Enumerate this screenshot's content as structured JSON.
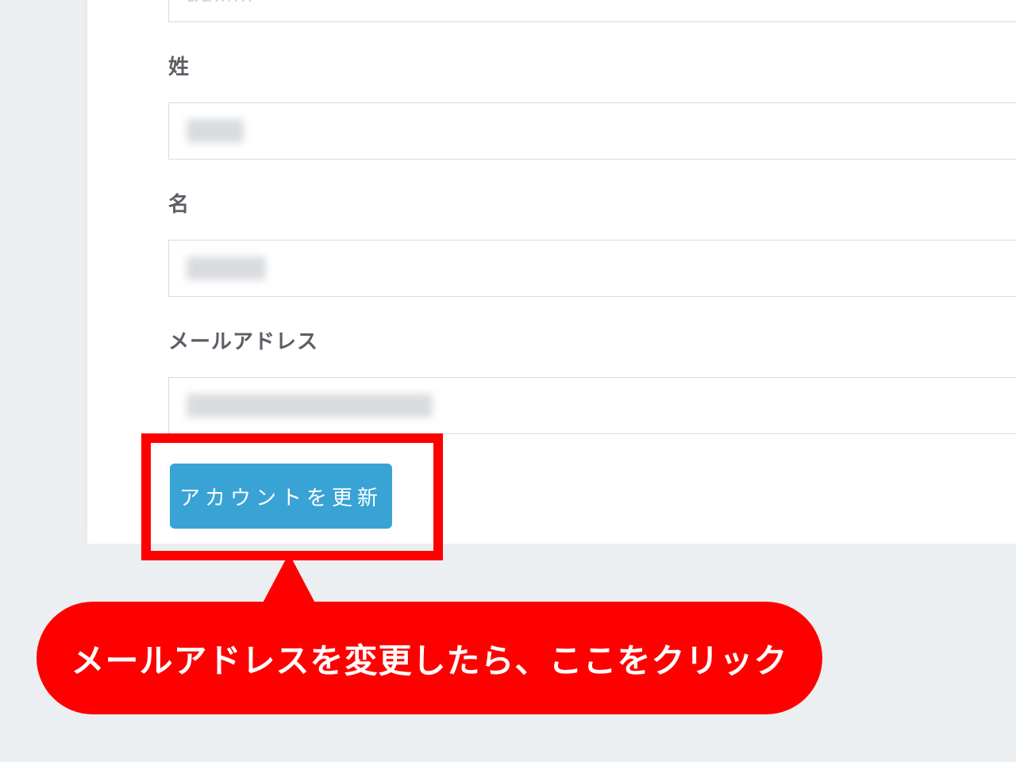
{
  "form": {
    "username_value": "admin",
    "lastname_label": "姓",
    "lastname_value": "",
    "firstname_label": "名",
    "firstname_value": "",
    "email_label": "メールアドレス",
    "email_value": "",
    "update_button_label": "アカウントを更新"
  },
  "annotation": {
    "callout_text": "メールアドレスを変更したら、ここをクリック"
  }
}
